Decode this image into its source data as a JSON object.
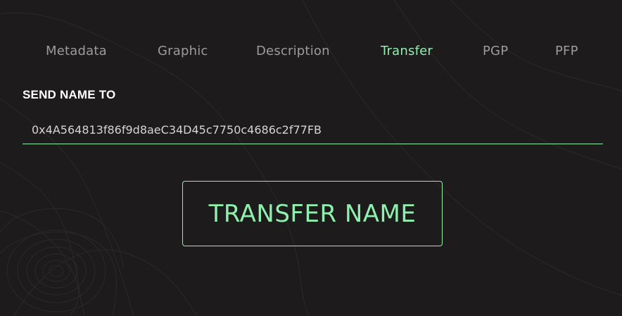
{
  "tabs": [
    {
      "label": "Metadata",
      "active": false
    },
    {
      "label": "Graphic",
      "active": false
    },
    {
      "label": "Description",
      "active": false
    },
    {
      "label": "Transfer",
      "active": true
    },
    {
      "label": "PGP",
      "active": false
    },
    {
      "label": "PFP",
      "active": false
    }
  ],
  "transfer": {
    "label": "SEND NAME TO",
    "address_value": "0x4A564813f86f9d8aeC34D45c7750c4686c2f77FB",
    "button_label": "TRANSFER NAME"
  },
  "colors": {
    "background": "#1d1b1c",
    "accent": "#8ff0ae",
    "tab_inactive": "#9d9b9c",
    "text": "#ffffff"
  }
}
